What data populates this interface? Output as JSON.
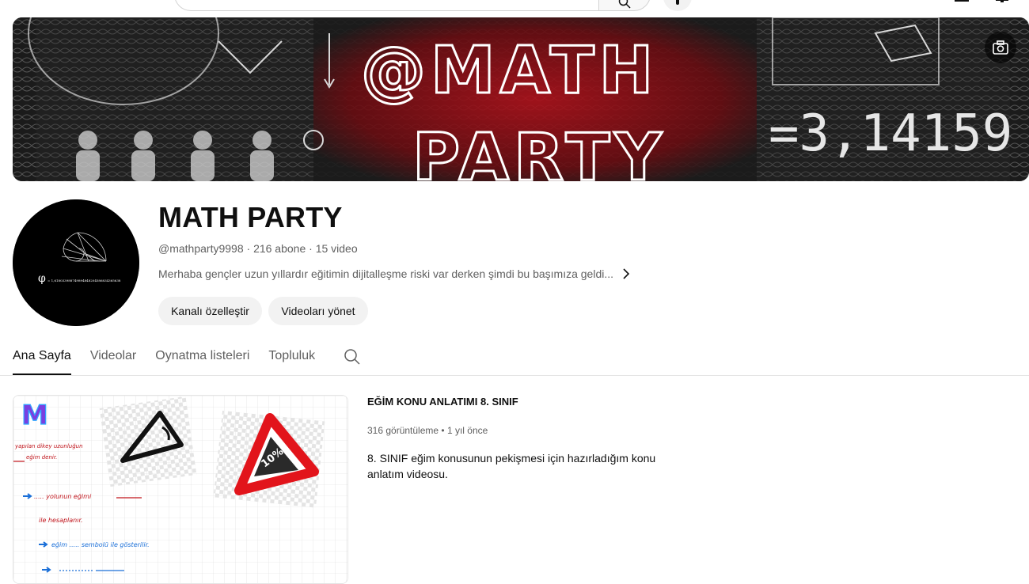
{
  "banner": {
    "line1": "@MATH",
    "line2": "PARTY",
    "pi_text": "=3,14159"
  },
  "avatar": {
    "phi_symbol": "φ",
    "formula": "= 1,618033988749894848204586834365638"
  },
  "channel": {
    "title": "MATH PARTY",
    "handle": "@mathparty9998",
    "subscribers": "216 abone",
    "videos": "15 video",
    "description": "Merhaba gençler uzun yıllardır eğitimin dijitalleşme riski var derken şimdi bu başımıza geldi..."
  },
  "buttons": {
    "customize": "Kanalı özelleştir",
    "manage": "Videoları yönet"
  },
  "tabs": [
    "Ana Sayfa",
    "Videolar",
    "Oynatma listeleri",
    "Topluluk"
  ],
  "featured": {
    "title": "EĞİM KONU ANLATIMI 8. SINIF",
    "views": "316 görüntüleme",
    "age": "1 yıl önce",
    "description": "8. SINIF eğim konusunun pekişmesi için hazırladığım konu anlatım videosu.",
    "thumb": {
      "logo": "M",
      "percent": "10%",
      "note1": "yapılan dikey uzunluğun",
      "note2": "eğim denir.",
      "note3": "..... yolunun eğimi",
      "note4": "ile hesaplanır.",
      "note5": "eğim ..... sembolü ile gösterilir."
    }
  },
  "colors": {
    "text_primary": "#0f0f0f",
    "text_secondary": "#606060",
    "pill_bg": "#f2f2f2",
    "banner_red": "#e0161f"
  }
}
